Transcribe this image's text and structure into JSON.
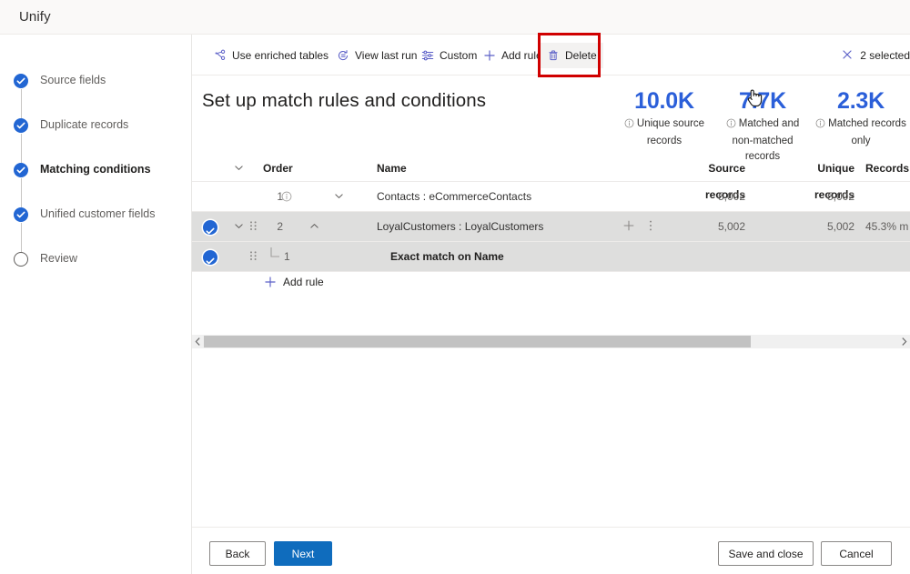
{
  "app": {
    "title": "Unify"
  },
  "sidebar": {
    "items": [
      {
        "label": "Source fields",
        "state": "done",
        "icon": "check-circle-icon"
      },
      {
        "label": "Duplicate records",
        "state": "done",
        "icon": "check-circle-icon"
      },
      {
        "label": "Matching conditions",
        "state": "current",
        "icon": "check-circle-icon"
      },
      {
        "label": "Unified customer fields",
        "state": "done",
        "icon": "check-circle-icon"
      },
      {
        "label": "Review",
        "state": "todo",
        "icon": "empty-circle-icon"
      }
    ]
  },
  "commandbar": {
    "items": [
      {
        "label": "Use enriched tables",
        "icon": "enrich-network-icon"
      },
      {
        "label": "View last run",
        "icon": "history-clock-icon"
      },
      {
        "label": "Custom",
        "icon": "sliders-icon"
      },
      {
        "label": "Add rule",
        "icon": "plus-icon"
      },
      {
        "label": "Delete",
        "icon": "trash-icon"
      }
    ],
    "selection_label": "2 selected",
    "selection_icon": "close-x-icon",
    "highlight_color": "#d00000"
  },
  "main": {
    "page_title": "Set up match rules and conditions",
    "kpis": [
      {
        "value": "10.0K",
        "label_line1": "Unique source",
        "label_line2": "records",
        "icon": "info-icon"
      },
      {
        "value": "7.7K",
        "label_line1": "Matched and",
        "label_line2": "non-matched records",
        "icon": "info-icon"
      },
      {
        "value": "2.3K",
        "label_line1": "Matched records",
        "label_line2": "only",
        "icon": "info-icon"
      }
    ],
    "kpi_value_color": "#2b5fd9",
    "grid": {
      "headers": {
        "order": "Order",
        "name": "Name",
        "source_records": "Source records",
        "unique_records": "Unique records",
        "records": "Records"
      },
      "rows": [
        {
          "selected": false,
          "order": "1",
          "name": "Contacts : eCommerceContacts",
          "source_records": "5,002",
          "unique_records": "5,002",
          "records": "",
          "indent": false,
          "bold": false
        },
        {
          "selected": true,
          "order": "2",
          "name": "LoyalCustomers : LoyalCustomers",
          "source_records": "5,002",
          "unique_records": "5,002",
          "records": "45.3% m",
          "indent": false,
          "bold": false
        },
        {
          "selected": true,
          "order": "1",
          "name": "Exact match on Name",
          "source_records": "",
          "unique_records": "",
          "records": "",
          "indent": true,
          "bold": true
        }
      ],
      "add_rule_label": "Add rule"
    }
  },
  "footer": {
    "back": "Back",
    "next": "Next",
    "save_and_close": "Save and close",
    "cancel": "Cancel"
  }
}
